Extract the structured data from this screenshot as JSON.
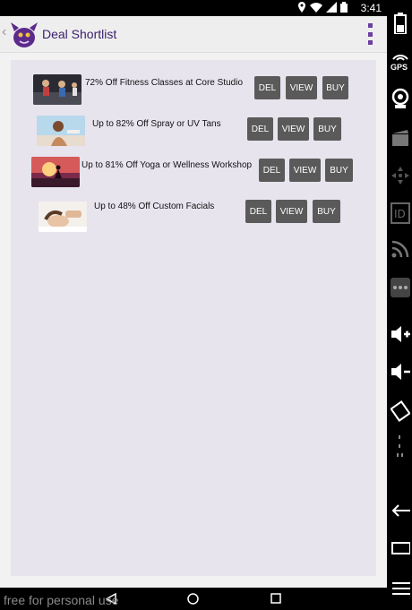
{
  "status": {
    "time": "3:41"
  },
  "app": {
    "title": "Deal Shortlist"
  },
  "buttons": {
    "del": "DEL",
    "view": "VIEW",
    "buy": "BUY"
  },
  "deals": [
    {
      "label": "72% Off Fitness Classes at Core Studio"
    },
    {
      "label": "Up to 82% Off Spray or UV Tans"
    },
    {
      "label": "Up to 81% Off Yoga or Wellness Workshop"
    },
    {
      "label": "Up to 48% Off Custom Facials"
    }
  ],
  "watermark": "free for personal use",
  "sidebar": {
    "gps": "GPS",
    "id": "ID"
  },
  "colors": {
    "title": "#3a1e6b",
    "menu": "#6a3fa0",
    "button": "#5a5a5a",
    "card": "#e8e4ee"
  }
}
